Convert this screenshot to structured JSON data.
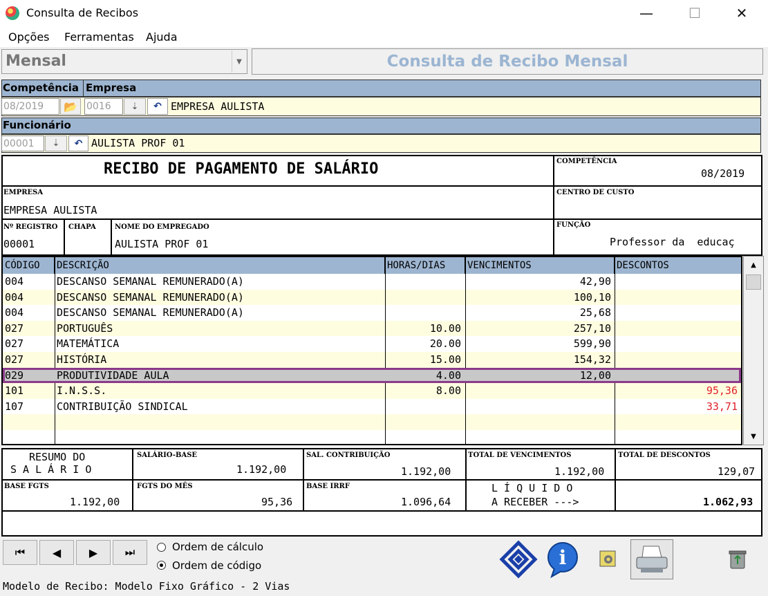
{
  "window": {
    "title": "Consulta de Recibos",
    "minimize": "—",
    "maximize": "☐",
    "close": "✕"
  },
  "menu": [
    "Opções",
    "Ferramentas",
    "Ajuda"
  ],
  "mode": {
    "selected": "Mensal",
    "header_title": "Consulta de Recibo Mensal"
  },
  "filters": {
    "competencia_label": "Competência",
    "empresa_label": "Empresa",
    "competencia_value": "08/2019",
    "empresa_code": "0016",
    "empresa_name": "EMPRESA AULISTA",
    "funcionario_label": "Funcionário",
    "funcionario_code": "00001",
    "funcionario_name": "AULISTA PROF 01"
  },
  "receipt": {
    "title": "RECIBO DE PAGAMENTO DE SALÁRIO",
    "competencia_label": "COMPETÊNCIA",
    "competencia_value": "08/2019",
    "empresa_label": "EMPRESA",
    "empresa_value": "EMPRESA AULISTA",
    "centro_label": "CENTRO DE CUSTO",
    "registro_label": "Nº REGISTRO",
    "registro_value": "00001",
    "chapa_label": "CHAPA",
    "empregado_label": "NOME DO EMPREGADO",
    "empregado_value": "AULISTA PROF 01",
    "funcao_label": "FUNÇÃO",
    "funcao_value": "Professor da  educaç"
  },
  "grid": {
    "headers": {
      "codigo": "CÓDIGO",
      "descricao": "DESCRIÇÃO",
      "horas": "HORAS/DIAS",
      "vencimentos": "VENCIMENTOS",
      "descontos": "DESCONTOS"
    },
    "rows": [
      {
        "codigo": "004",
        "descricao": "DESCANSO SEMANAL REMUNERADO(A)",
        "horas": "",
        "vencimentos": "42,90",
        "descontos": ""
      },
      {
        "codigo": "004",
        "descricao": "DESCANSO SEMANAL REMUNERADO(A)",
        "horas": "",
        "vencimentos": "100,10",
        "descontos": ""
      },
      {
        "codigo": "004",
        "descricao": "DESCANSO SEMANAL REMUNERADO(A)",
        "horas": "",
        "vencimentos": "25,68",
        "descontos": ""
      },
      {
        "codigo": "027",
        "descricao": "PORTUGUÊS",
        "horas": "10.00",
        "vencimentos": "257,10",
        "descontos": ""
      },
      {
        "codigo": "027",
        "descricao": "MATEMÁTICA",
        "horas": "20.00",
        "vencimentos": "599,90",
        "descontos": ""
      },
      {
        "codigo": "027",
        "descricao": "HISTÓRIA",
        "horas": "15.00",
        "vencimentos": "154,32",
        "descontos": ""
      },
      {
        "codigo": "029",
        "descricao": "PRODUTIVIDADE AULA",
        "horas": "4.00",
        "vencimentos": "12,00",
        "descontos": ""
      },
      {
        "codigo": "101",
        "descricao": "I.N.S.S.",
        "horas": "8.00",
        "vencimentos": "",
        "descontos": "95,36"
      },
      {
        "codigo": "107",
        "descricao": "CONTRIBUIÇÃO SINDICAL",
        "horas": "",
        "vencimentos": "",
        "descontos": "33,71"
      }
    ],
    "selected_row": 6
  },
  "summary": {
    "resumo_line1": "RESUMO DO",
    "resumo_line2": "S A L Á R I O",
    "salario_base_label": "SALÁRIO-BASE",
    "salario_base": "1.192,00",
    "sal_contrib_label": "SAL. CONTRIBUIÇÃO",
    "sal_contrib": "1.192,00",
    "total_venc_label": "TOTAL DE VENCIMENTOS",
    "total_venc": "1.192,00",
    "total_desc_label": "TOTAL DE DESCONTOS",
    "total_desc": "129,07",
    "base_fgts_label": "BASE FGTS",
    "base_fgts": "1.192,00",
    "fgts_mes_label": "FGTS DO MÊS",
    "fgts_mes": "95,36",
    "base_irrf_label": "BASE IRRF",
    "base_irrf": "1.096,64",
    "liquido_line1": "L Í Q U I D O",
    "liquido_line2": "A RECEBER --->",
    "liquido": "1.062,93"
  },
  "bottom": {
    "nav": [
      "⏮",
      "◀",
      "▶",
      "⏭"
    ],
    "ordem_calculo": "Ordem de cálculo",
    "ordem_codigo": "Ordem de código",
    "modelo": "Modelo de Recibo: Modelo Fixo Gráfico - 2 Vias"
  },
  "colors": {
    "header_blue": "#9db5d0",
    "field_yellow": "#fffde0",
    "selection": "#8a3a8a",
    "discount_red": "#e0202a"
  }
}
